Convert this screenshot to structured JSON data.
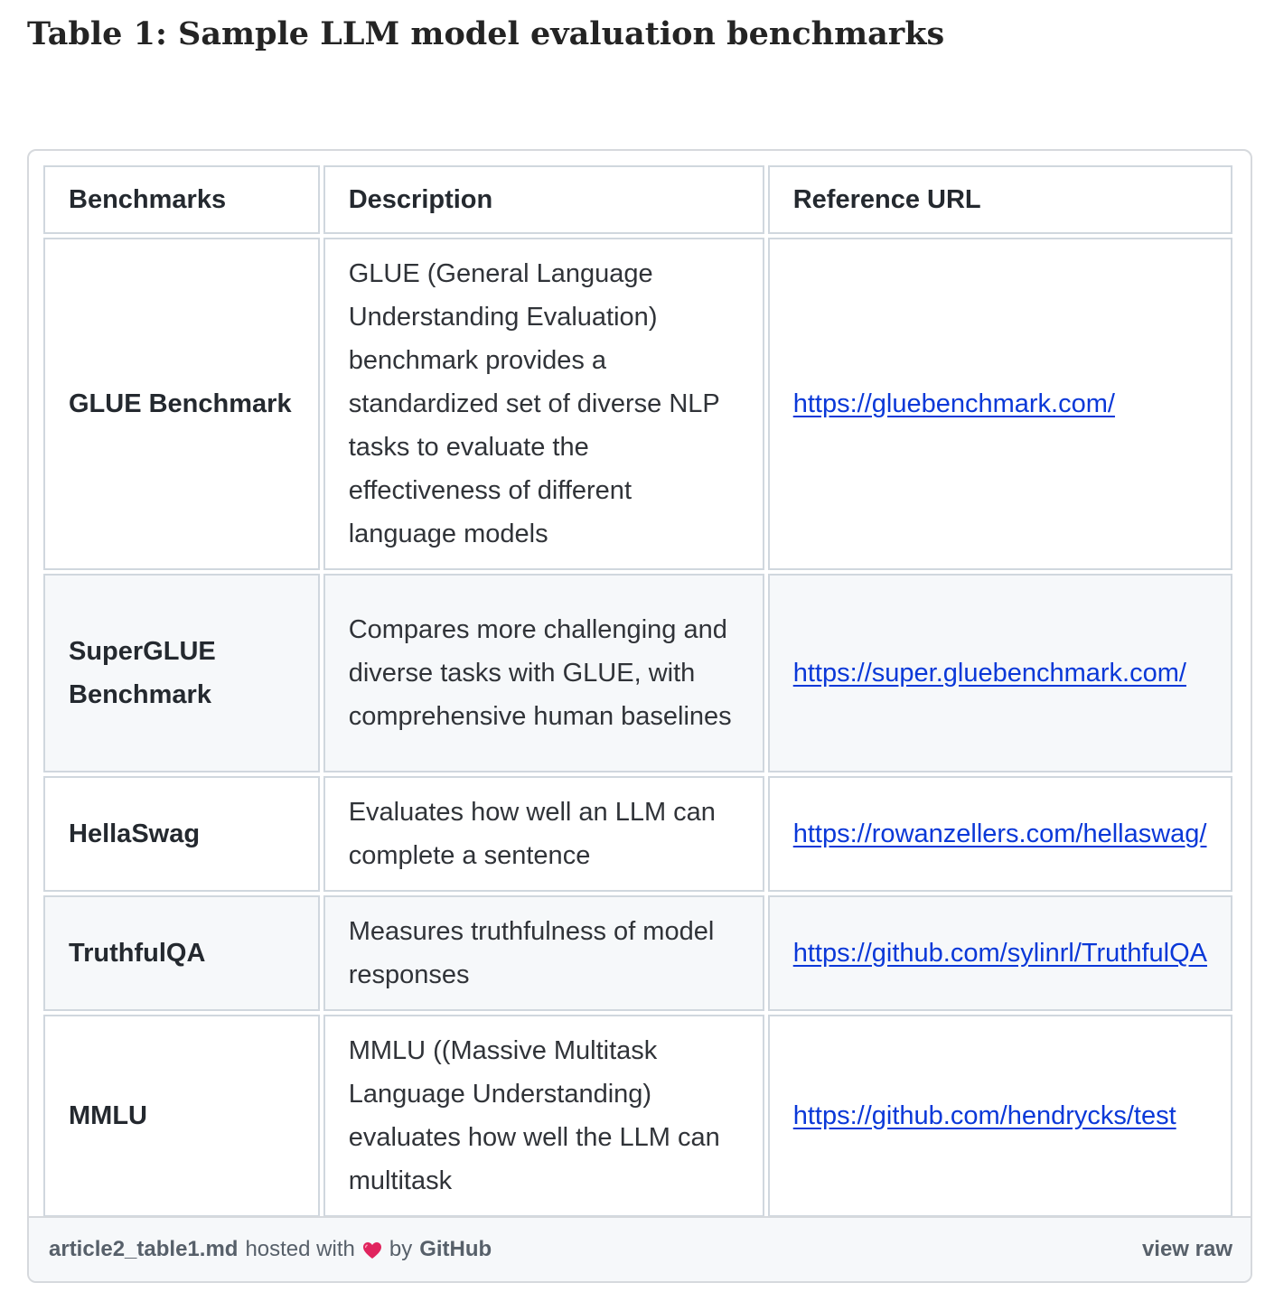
{
  "page": {
    "title": "Table 1: Sample LLM model evaluation benchmarks"
  },
  "table": {
    "headers": [
      "Benchmarks",
      "Description",
      "Reference URL"
    ],
    "rows": [
      {
        "name": "GLUE Benchmark",
        "description": "GLUE (General Language Understanding Evaluation) benchmark provides a standardized set of diverse NLP tasks to evaluate the effectiveness of different language models",
        "url": "https://gluebenchmark.com/"
      },
      {
        "name": "SuperGLUE Benchmark",
        "description": "Compares more challenging and diverse tasks with GLUE, with comprehensive human baselines",
        "url": "https://super.gluebenchmark.com/"
      },
      {
        "name": "HellaSwag",
        "description": "Evaluates how well an LLM can complete a sentence",
        "url": "https://rowanzellers.com/hellaswag/"
      },
      {
        "name": "TruthfulQA",
        "description": "Measures truthfulness of model responses",
        "url": "https://github.com/sylinrl/TruthfulQA"
      },
      {
        "name": "MMLU",
        "description": "MMLU ((Massive Multitask Language Understanding) evaluates how well the LLM can multitask",
        "url": "https://github.com/hendrycks/test"
      }
    ]
  },
  "footer": {
    "file": "article2_table1.md",
    "hosted_with": "hosted with",
    "heart_icon": "heart-icon",
    "by": "by",
    "host": "GitHub",
    "view_raw": "view raw"
  },
  "colors": {
    "link": "#0a38d8",
    "border": "#d0d7de",
    "alt_row": "#f6f8fa",
    "heart": "#e0245e"
  }
}
